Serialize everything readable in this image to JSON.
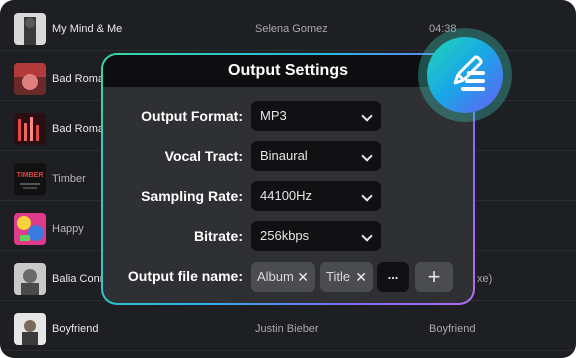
{
  "songs": [
    {
      "title": "My Mind & Me",
      "artist": "Selena Gomez",
      "meta": "04:38"
    },
    {
      "title": "Bad Roma",
      "artist": "",
      "meta": ""
    },
    {
      "title": "Bad Roma",
      "artist": "",
      "meta": ""
    },
    {
      "title": "Timber",
      "artist": "",
      "meta": "",
      "thumb_text": "TIMBER"
    },
    {
      "title": "Happy",
      "artist": "",
      "meta": ""
    },
    {
      "title": "Balia Conn",
      "artist": "",
      "meta": "xe)"
    },
    {
      "title": "Boyfriend",
      "artist": "Justin Bieber",
      "meta": "Boyfriend"
    }
  ],
  "dialog": {
    "title": "Output Settings",
    "fields": [
      {
        "label": "Output Format:",
        "value": "MP3"
      },
      {
        "label": "Vocal Tract:",
        "value": "Binaural"
      },
      {
        "label": "Sampling Rate:",
        "value": "44100Hz"
      },
      {
        "label": "Bitrate:",
        "value": "256kbps"
      }
    ],
    "filename": {
      "label": "Output file name:",
      "tags": [
        "Album",
        "Title"
      ],
      "more": "...",
      "add": "+"
    }
  },
  "icons": {
    "close": "close-icon",
    "chevron": "chevron-down-icon",
    "edit_badge": "edit-list-icon"
  },
  "colors": {
    "accent_start": "#3ad6a3",
    "accent_end": "#7b6cf6"
  }
}
